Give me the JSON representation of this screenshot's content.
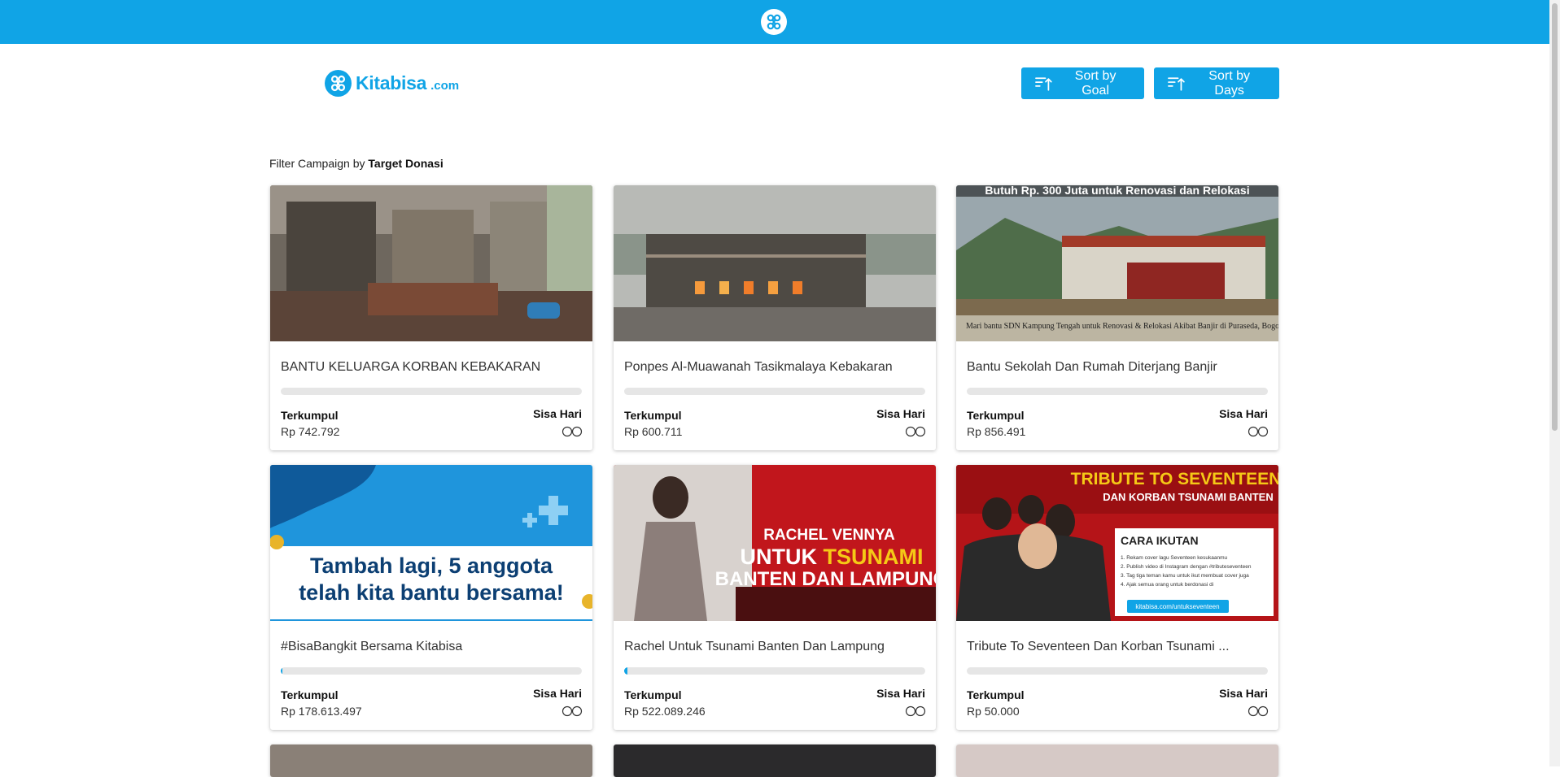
{
  "brand": {
    "name": "Kitabisa",
    "domain": ".com",
    "color": "#10a4e6"
  },
  "toolbar": {
    "sort_goal_label": "Sort by Goal",
    "sort_days_label": "Sort by Days"
  },
  "filter": {
    "prefix": "Filter Campaign by ",
    "value": "Target Donasi"
  },
  "labels": {
    "collected": "Terkumpul",
    "days_left": "Sisa Hari"
  },
  "campaigns": [
    {
      "title": "BANTU KELUARGA KORBAN KEBAKARAN",
      "amount": "Rp 742.792",
      "progress_percent": 0,
      "days_left_icon": "infinity-icon"
    },
    {
      "title": "Ponpes Al-Muawanah Tasikmalaya Kebakaran",
      "amount": "Rp 600.711",
      "progress_percent": 0,
      "days_left_icon": "infinity-icon"
    },
    {
      "title": "Bantu Sekolah Dan Rumah Diterjang Banjir",
      "amount": "Rp 856.491",
      "progress_percent": 0,
      "days_left_icon": "infinity-icon",
      "image_caption_top": "Butuh Rp. 300 Juta untuk Renovasi dan Relokasi",
      "image_caption_bottom": "Mari bantu SDN Kampung Tengah untuk Renovasi & Relokasi Akibat Banjir di Puraseda, Bogor"
    },
    {
      "title": "#BisaBangkit Bersama Kitabisa",
      "amount": "Rp 178.613.497",
      "progress_percent": 0.5,
      "days_left_icon": "infinity-icon",
      "image_line1": "Tambah lagi, 5 anggota",
      "image_line2": "telah kita bantu bersama!"
    },
    {
      "title": "Rachel Untuk Tsunami Banten Dan Lampung",
      "amount": "Rp 522.089.246",
      "progress_percent": 1,
      "days_left_icon": "infinity-icon",
      "image_line1": "RACHEL VENNYA",
      "image_line2a": "UNTUK ",
      "image_line2b": "TSUNAMI",
      "image_line3": "BANTEN DAN LAMPUNG"
    },
    {
      "title": "Tribute To Seventeen Dan Korban Tsunami ...",
      "amount": "Rp 50.000",
      "progress_percent": 0,
      "days_left_icon": "infinity-icon",
      "image_line1": "TRIBUTE TO SEVENTEEN",
      "image_line2": "DAN KORBAN TSUNAMI BANTEN",
      "image_box_title": "CARA IKUTAN",
      "image_steps": [
        "1. Rekam cover lagu Seventeen kesukaanmu",
        "2. Publish video di Instagram dengan #tributeseventeen",
        "3. Tag tiga teman kamu untuk ikut membuat cover juga",
        "4. Ajak semua orang untuk berdonasi di"
      ],
      "image_link": "kitabisa.com/untukseventeen"
    }
  ]
}
